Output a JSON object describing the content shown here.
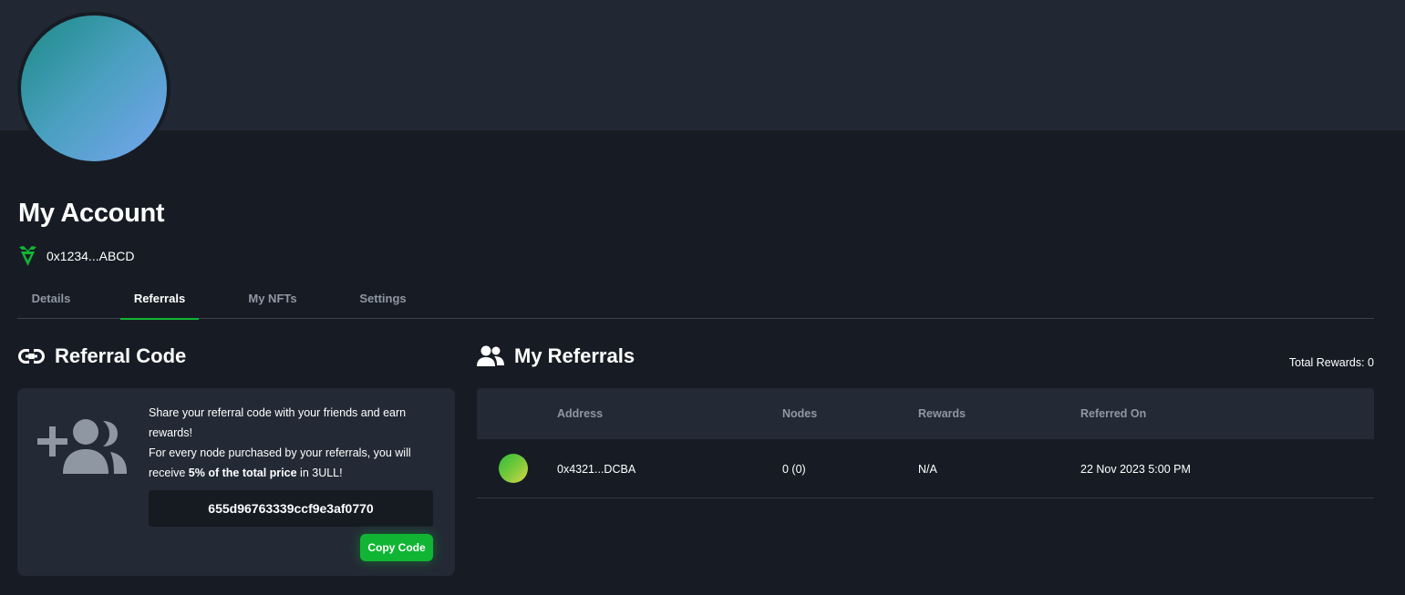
{
  "profile": {
    "title": "My Account",
    "wallet_address": "0x1234...ABCD",
    "accent_color": "#10b534"
  },
  "tabs": [
    {
      "label": "Details",
      "active": false
    },
    {
      "label": "Referrals",
      "active": true
    },
    {
      "label": "My NFTs",
      "active": false
    },
    {
      "label": "Settings",
      "active": false
    }
  ],
  "referral_code": {
    "title": "Referral Code",
    "description_line1": "Share your referral code with your friends and earn rewards!",
    "description_line2_prefix": "For every node purchased by your referrals, you will receive ",
    "description_line2_bold": "5% of the total price",
    "description_line2_suffix": " in 3ULL!",
    "code": "655d96763339ccf9e3af0770",
    "copy_label": "Copy Code"
  },
  "referrals": {
    "title": "My Referrals",
    "total_rewards": "Total Rewards: 0",
    "columns": [
      "Address",
      "Nodes",
      "Rewards",
      "Referred On"
    ],
    "rows": [
      {
        "address": "0x4321...DCBA",
        "nodes": "0 (0)",
        "rewards": "N/A",
        "referred_on": "22 Nov 2023 5:00 PM"
      }
    ]
  }
}
